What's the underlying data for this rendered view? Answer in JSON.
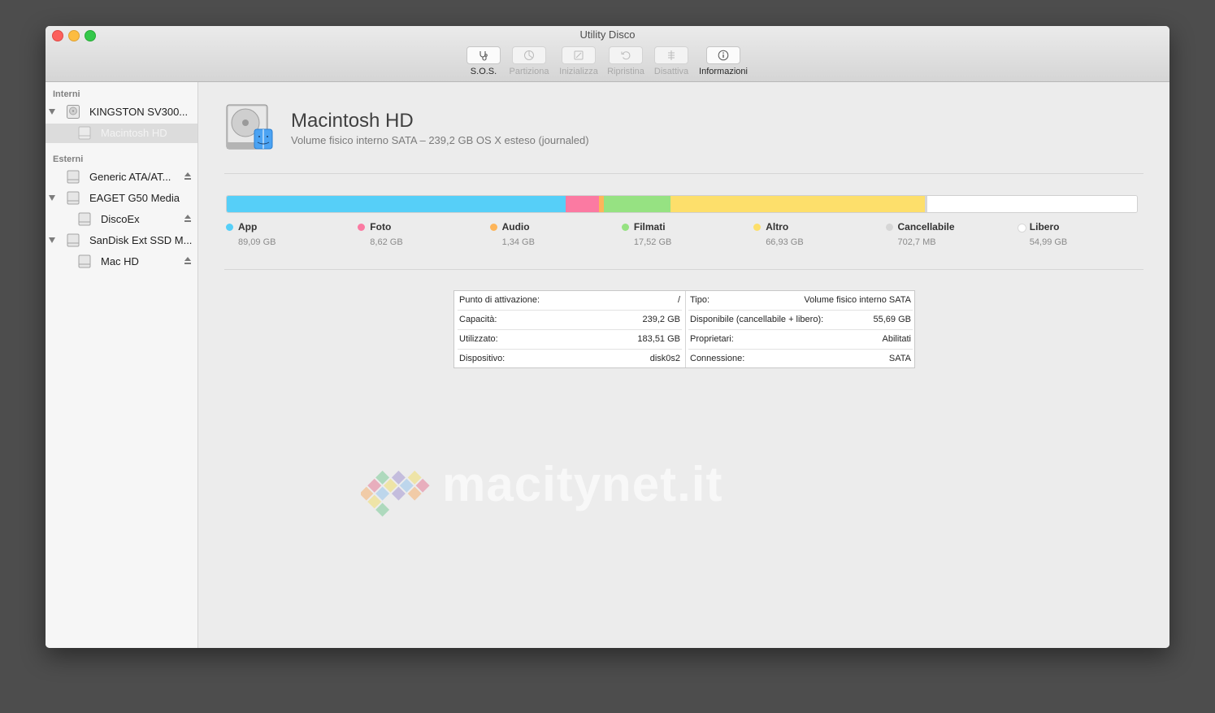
{
  "window": {
    "title": "Utility Disco"
  },
  "toolbar": {
    "items": [
      {
        "label": "S.O.S.",
        "icon": "stethoscope-icon",
        "enabled": true
      },
      {
        "label": "Partiziona",
        "icon": "partition-icon",
        "enabled": false
      },
      {
        "label": "Inizializza",
        "icon": "erase-icon",
        "enabled": false
      },
      {
        "label": "Ripristina",
        "icon": "restore-icon",
        "enabled": false
      },
      {
        "label": "Disattiva",
        "icon": "unmount-icon",
        "enabled": false
      },
      {
        "label": "Informazioni",
        "icon": "info-icon",
        "enabled": true
      }
    ]
  },
  "sidebar": {
    "internal_header": "Interni",
    "external_header": "Esterni",
    "internal": [
      {
        "label": "KINGSTON SV300...",
        "level": 0,
        "expanded": true,
        "eject": false
      },
      {
        "label": "Macintosh HD",
        "level": 1,
        "selected": true,
        "eject": false
      }
    ],
    "external": [
      {
        "label": "Generic ATA/AT...",
        "level": 0,
        "expanded": false,
        "eject": true
      },
      {
        "label": "EAGET G50 Media",
        "level": 0,
        "expanded": true,
        "eject": false
      },
      {
        "label": "DiscoEx",
        "level": 1,
        "eject": true
      },
      {
        "label": "SanDisk Ext SSD M...",
        "level": 0,
        "expanded": true,
        "eject": false
      },
      {
        "label": "Mac HD",
        "level": 1,
        "eject": true
      }
    ]
  },
  "volume": {
    "name": "Macintosh HD",
    "description": "Volume fisico interno SATA – 239,2 GB OS X esteso (journaled)"
  },
  "usage": {
    "total_gb": 239.2,
    "categories": [
      {
        "name": "App",
        "size": "89,09 GB",
        "gb": 89.09,
        "color": "#56cff8"
      },
      {
        "name": "Foto",
        "size": "8,62 GB",
        "gb": 8.62,
        "color": "#fb7aa2"
      },
      {
        "name": "Audio",
        "size": "1,34 GB",
        "gb": 1.34,
        "color": "#fdb55a"
      },
      {
        "name": "Filmati",
        "size": "17,52 GB",
        "gb": 17.52,
        "color": "#96e282"
      },
      {
        "name": "Altro",
        "size": "66,93 GB",
        "gb": 66.93,
        "color": "#fddf6b"
      },
      {
        "name": "Cancellabile",
        "size": "702,7 MB",
        "gb": 0.7027,
        "color": "#d6d6d6"
      },
      {
        "name": "Libero",
        "size": "54,99 GB",
        "gb": 54.99,
        "color": "#ffffff"
      }
    ]
  },
  "info": {
    "left": [
      {
        "key": "Punto di attivazione:",
        "value": "/"
      },
      {
        "key": "Capacità:",
        "value": "239,2 GB"
      },
      {
        "key": "Utilizzato:",
        "value": "183,51 GB"
      },
      {
        "key": "Dispositivo:",
        "value": "disk0s2"
      }
    ],
    "right": [
      {
        "key": "Tipo:",
        "value": "Volume fisico interno SATA"
      },
      {
        "key": "Disponibile (cancellabile + libero):",
        "value": "55,69 GB"
      },
      {
        "key": "Proprietari:",
        "value": "Abilitati"
      },
      {
        "key": "Connessione:",
        "value": "SATA"
      }
    ]
  },
  "watermark": {
    "text": "macitynet.it"
  }
}
